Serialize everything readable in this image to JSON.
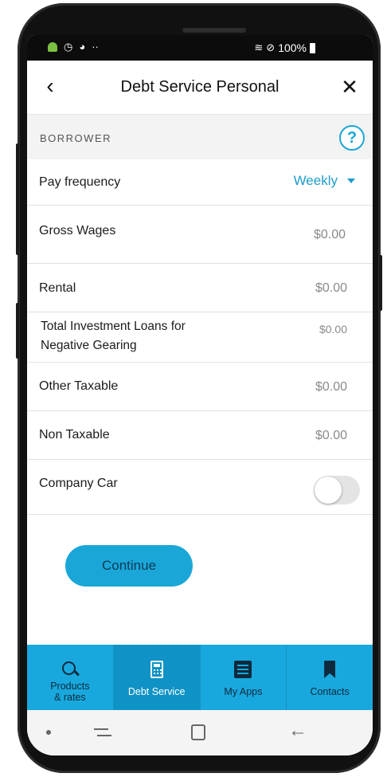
{
  "status_bar": {
    "battery": "100%",
    "left_icons": [
      "android-icon",
      "clock-icon",
      "sync-icon"
    ],
    "right_icons": [
      "wifi-icon",
      "do-not-disturb-icon",
      "battery-icon"
    ]
  },
  "header": {
    "back_glyph": "‹",
    "title": "Debt Service Personal",
    "close_glyph": "✕"
  },
  "section": {
    "label": "BORROWER",
    "help_glyph": "?"
  },
  "pay_frequency": {
    "label": "Pay frequency",
    "value": "Weekly"
  },
  "fields": {
    "gross_wages": {
      "label": "Gross Wages",
      "value": "$0.00"
    },
    "rental": {
      "label": "Rental",
      "value": "$0.00"
    },
    "total_investment": {
      "label_line1": "Total Investment Loans for",
      "label_line2": "Negative Gearing",
      "value": "$0.00"
    },
    "other_taxable": {
      "label": "Other Taxable",
      "value": "$0.00"
    },
    "non_taxable": {
      "label": "Non Taxable",
      "value": "$0.00"
    },
    "company_car": {
      "label": "Company Car",
      "toggle_on": false
    }
  },
  "continue_label": "Continue",
  "tabs": [
    {
      "label_line1": "Products",
      "label_line2": "& rates",
      "icon": "search-icon"
    },
    {
      "label": "Debt Service",
      "icon": "calculator-icon",
      "active": true
    },
    {
      "label": "My Apps",
      "icon": "list-icon"
    },
    {
      "label": "Contacts",
      "icon": "bookmark-icon"
    }
  ],
  "colors": {
    "accent": "#1aa7d8",
    "tabbar": "#19a8dd",
    "tab_active": "#0f93c6",
    "dropdown_text": "#1e9cc9"
  }
}
